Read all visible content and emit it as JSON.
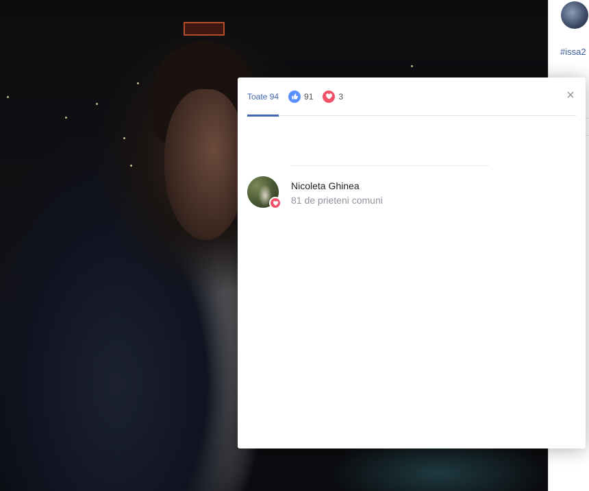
{
  "tabs": {
    "all_label": "Toate 94",
    "like_count": "91",
    "love_count": "3"
  },
  "close_symbol": "×",
  "reactors": [
    {
      "name": "Nicoleta Ghinea",
      "mutual_friends": "81 de prieteni comuni",
      "reaction_icon": "love-icon"
    }
  ],
  "right_strip": {
    "hashtag": "#issa2"
  },
  "colors": {
    "accent": "#4267b2",
    "like": "#5890ff",
    "love": "#f25268"
  }
}
